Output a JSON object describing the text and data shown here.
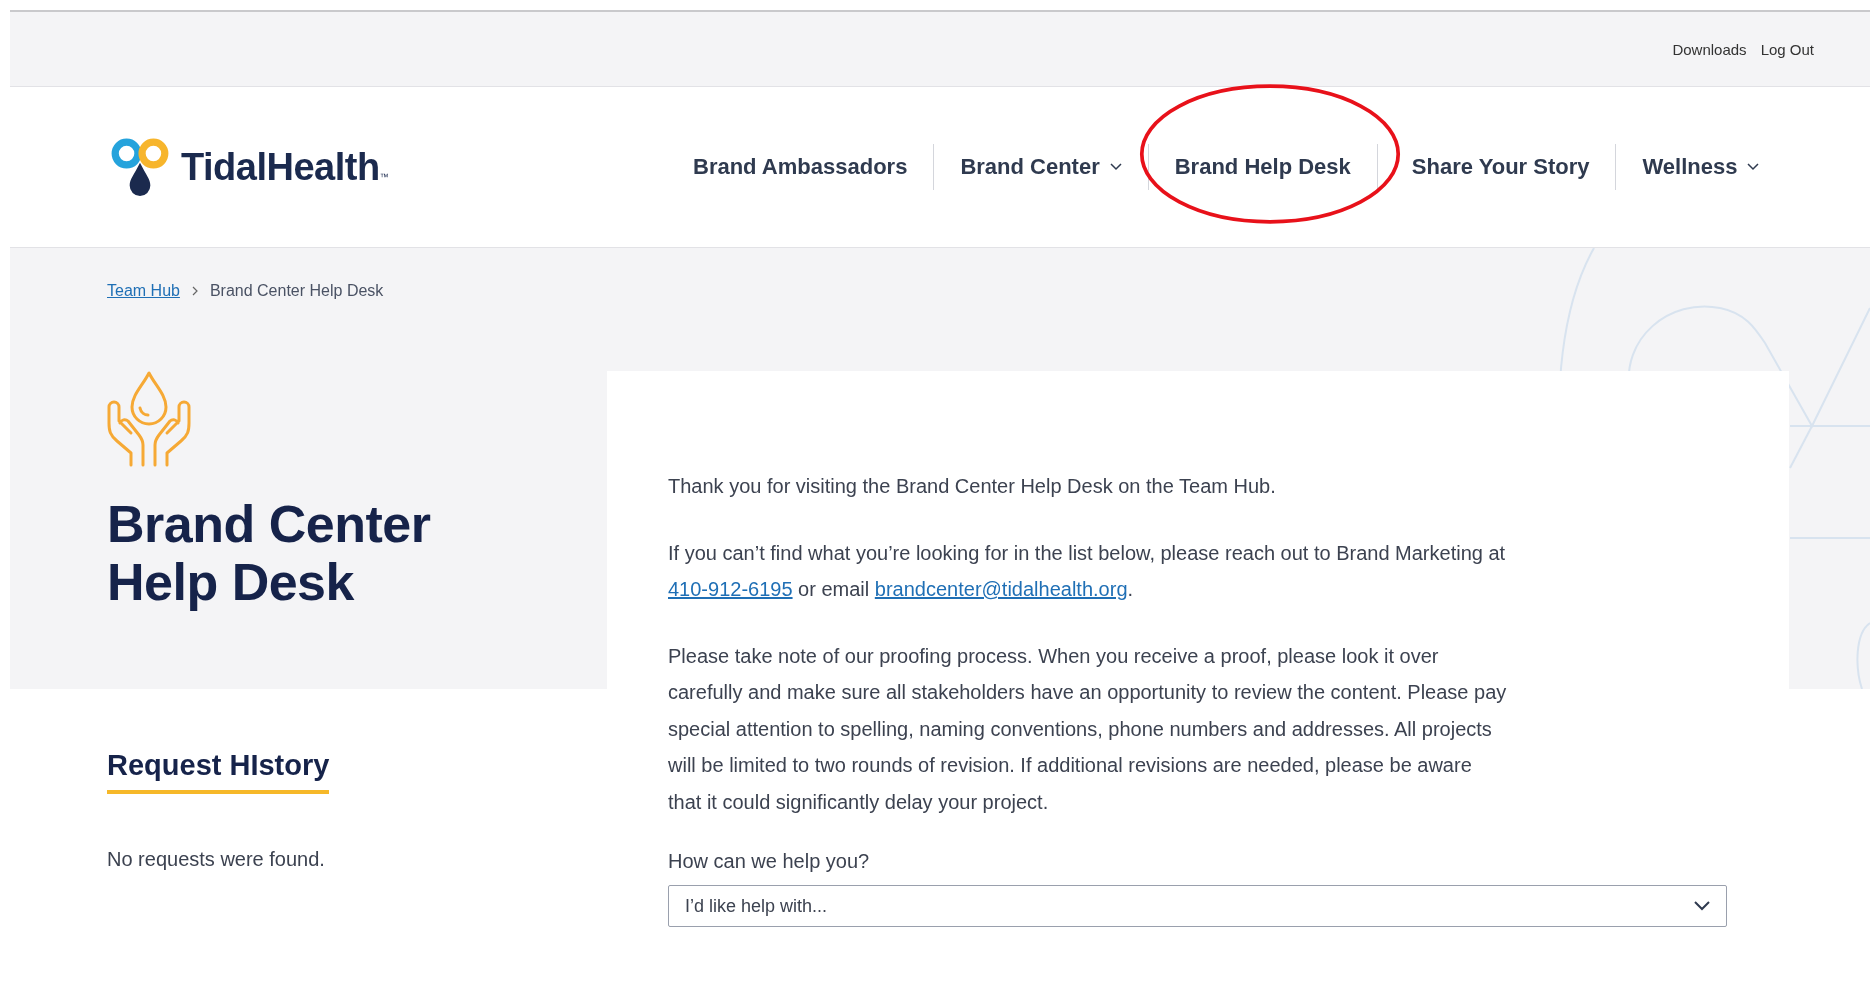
{
  "utility_links": [
    "Downloads",
    "Log Out"
  ],
  "logo": {
    "text": "TidalHealth",
    "mark": "™"
  },
  "nav": [
    {
      "label": "Brand Ambassadors",
      "has_menu": false,
      "circled": false
    },
    {
      "label": "Brand Center",
      "has_menu": true,
      "circled": false
    },
    {
      "label": "Brand Help Desk",
      "has_menu": false,
      "circled": true
    },
    {
      "label": "Share Your Story",
      "has_menu": false,
      "circled": false
    },
    {
      "label": "Wellness",
      "has_menu": true,
      "circled": false
    }
  ],
  "breadcrumb": {
    "link": "Team Hub",
    "current": "Brand Center Help Desk"
  },
  "page_title": "Brand Center Help Desk",
  "request_history": {
    "heading": "Request HIstory",
    "empty_text": "No requests were found."
  },
  "card": {
    "intro": "Thank you for visiting the Brand Center Help Desk on the Team Hub.",
    "contact": {
      "before": "If you can’t find what you’re looking for in the list below, please reach out to Brand Marketing at",
      "phone": "410-912-6195",
      "middle": "or email",
      "email": "brandcenter@tidalhealth.org",
      "after": "."
    },
    "proofing": "Please take note of our proofing process. When you receive a proof, please look it over carefully and make sure all stakeholders have an opportunity to review the content. Please pay special attention to spelling, naming conventions, phone numbers and addresses. All projects will be limited to two rounds of revision. If additional revisions are needed, please be aware that it could significantly delay your project.",
    "select_label": "How can we help you?",
    "select_placeholder": "I’d like help with..."
  }
}
